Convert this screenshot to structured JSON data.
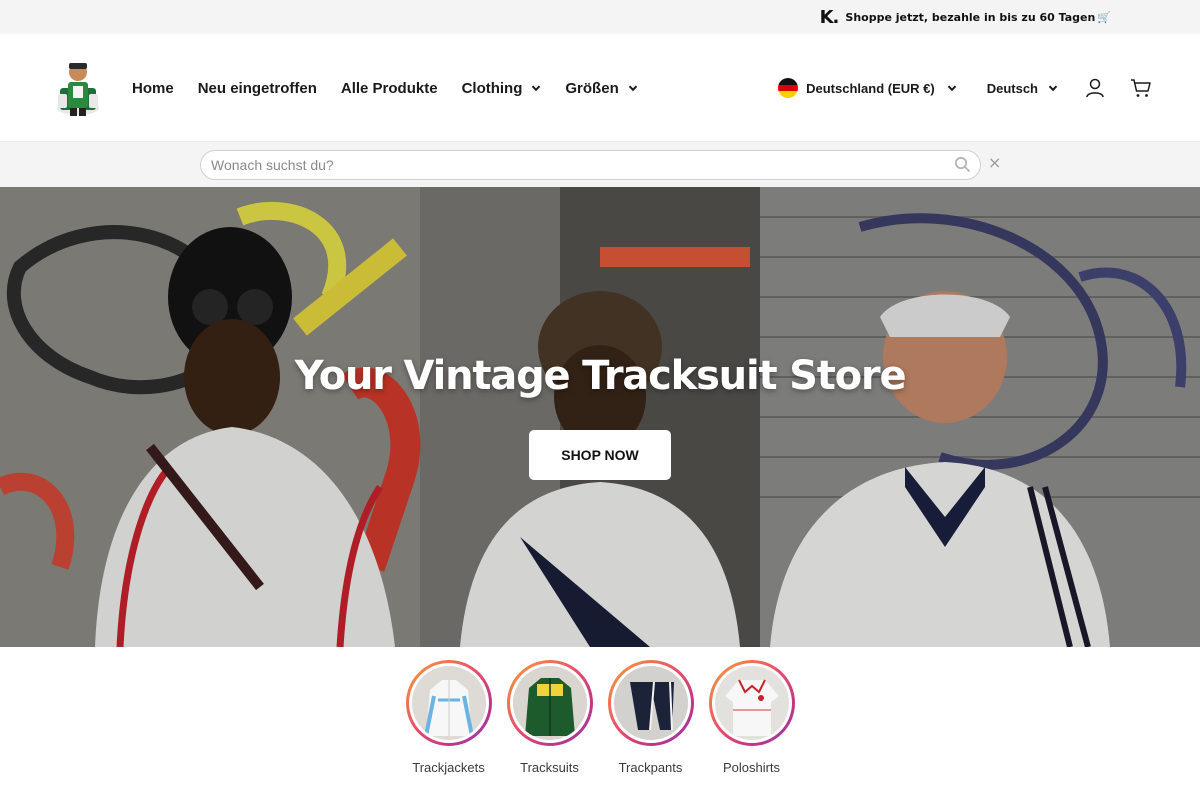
{
  "announcement": {
    "brand_mark": "K.",
    "text": "Shoppe jetzt, bezahle in bis zu 60 Tagen",
    "emoji_icon": "cart-icon"
  },
  "header": {
    "logo_icon": "store-mascot-logo",
    "nav": [
      {
        "label": "Home",
        "has_dropdown": false
      },
      {
        "label": "Neu eingetroffen",
        "has_dropdown": false
      },
      {
        "label": "Alle Produkte",
        "has_dropdown": false
      },
      {
        "label": "Clothing",
        "has_dropdown": true
      },
      {
        "label": "Größen",
        "has_dropdown": true
      }
    ],
    "locale": {
      "label": "Deutschland (EUR €)",
      "flag_colors": [
        "#111111",
        "#dd0000",
        "#ffce00"
      ]
    },
    "language": {
      "label": "Deutsch"
    },
    "icons": [
      "account-icon",
      "cart-icon"
    ]
  },
  "search": {
    "placeholder": "Wonach suchst du?",
    "value": "",
    "close_glyph": "×"
  },
  "hero": {
    "title": "Your Vintage Tracksuit Store",
    "cta_label": "SHOP NOW"
  },
  "categories": [
    {
      "label": "Trackjackets",
      "icon": "trackjacket-thumbnail"
    },
    {
      "label": "Tracksuits",
      "icon": "tracksuit-thumbnail"
    },
    {
      "label": "Trackpants",
      "icon": "trackpants-thumbnail"
    },
    {
      "label": "Poloshirts",
      "icon": "poloshirt-thumbnail"
    }
  ],
  "colors": {
    "accent_gradient": [
      "#f7a234",
      "#e94f6a",
      "#c13584",
      "#8a3ab9"
    ],
    "announcement_bg": "#f4f4f4",
    "text": "#1a1a1a"
  }
}
